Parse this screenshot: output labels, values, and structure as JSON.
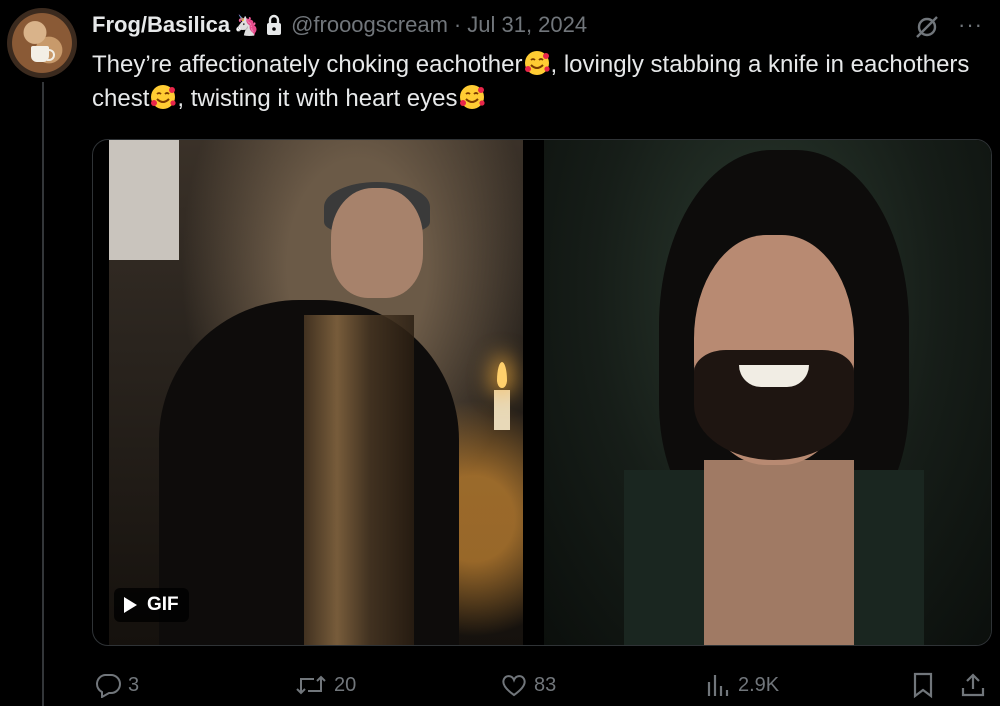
{
  "author": {
    "name": "Frog/Basilica",
    "badge_emoji": "🦄",
    "handle": "@frooogscream",
    "date": "Jul 31, 2024"
  },
  "tweet": {
    "part1": "They’re affectionately choking eachother",
    "part2": ", lovingly stabbing a knife in eachothers chest",
    "part3": ", twisting it with heart eyes",
    "emoji_icon": "smiling-face-with-hearts-icon"
  },
  "media": {
    "gif_label": "GIF"
  },
  "actions": {
    "replies": "3",
    "reposts": "20",
    "likes": "83",
    "views": "2.9K"
  },
  "colors": {
    "background": "#000000",
    "text": "#e7e9ea",
    "muted": "#71767b",
    "border": "#2f3336"
  }
}
